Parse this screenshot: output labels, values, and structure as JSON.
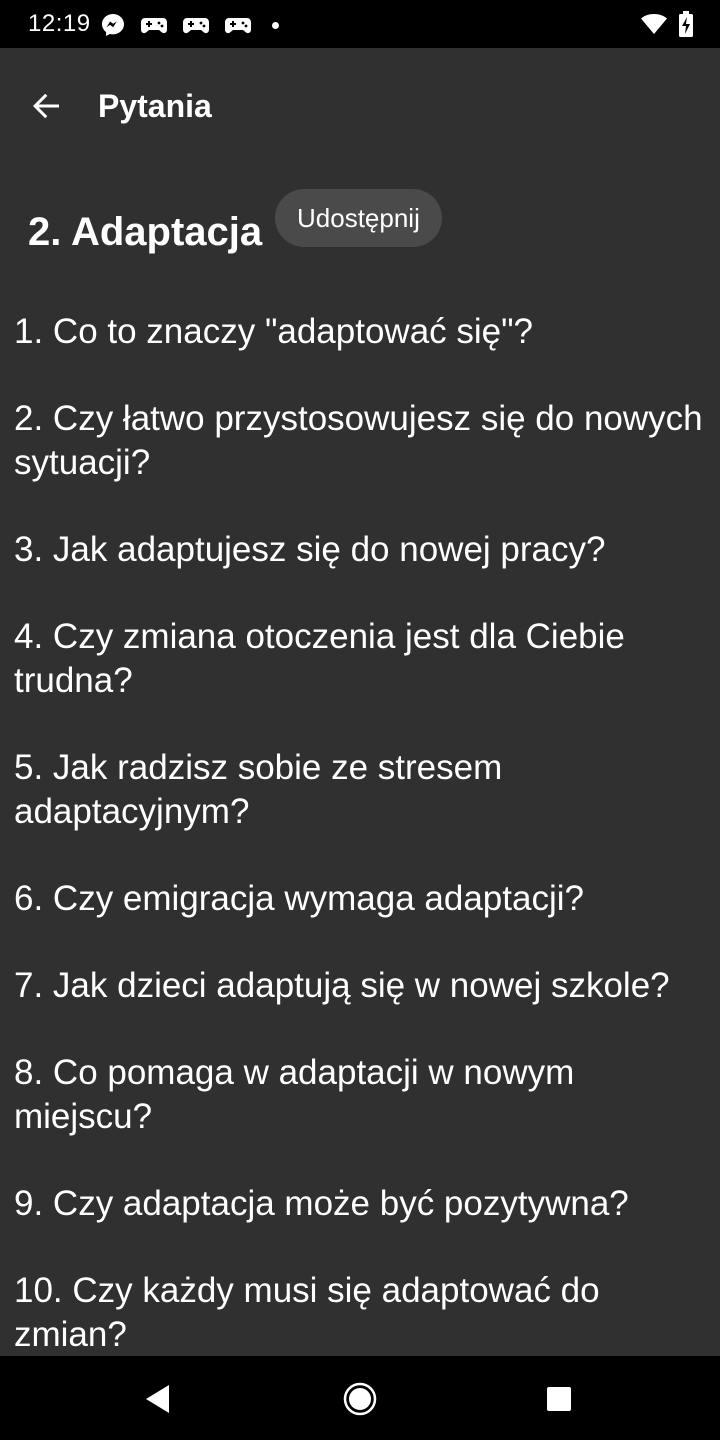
{
  "status_bar": {
    "time": "12:19",
    "left_icons": [
      "messenger-icon",
      "game-controller-icon",
      "game-controller-icon",
      "game-controller-icon",
      "notification-dot-icon"
    ],
    "right_icons": [
      "wifi-icon",
      "battery-charging-icon"
    ]
  },
  "toolbar": {
    "title": "Pytania",
    "back_icon": "arrow-back-icon"
  },
  "section": {
    "title": "2. Adaptacja",
    "share_label": "Udostępnij"
  },
  "questions": [
    "1. Co to znaczy \"adaptować się\"?",
    "2. Czy łatwo przystosowujesz się do nowych sytuacji?",
    "3. Jak adaptujesz się do nowej pracy?",
    "4. Czy zmiana otoczenia jest dla Ciebie trudna?",
    "5. Jak radzisz sobie ze stresem adaptacyjnym?",
    "6. Czy emigracja wymaga adaptacji?",
    "7. Jak dzieci adaptują się w nowej szkole?",
    "8. Co pomaga w adaptacji w nowym miejscu?",
    "9. Czy adaptacja może być pozytywna?",
    "10. Czy każdy musi się adaptować do zmian?"
  ],
  "nav_bar": {
    "icons": [
      "nav-back-icon",
      "nav-home-icon",
      "nav-recents-icon"
    ]
  },
  "colors": {
    "background": "#303030",
    "status_bar": "#000000",
    "chip": "#4a4a4a",
    "text": "#ffffff"
  }
}
